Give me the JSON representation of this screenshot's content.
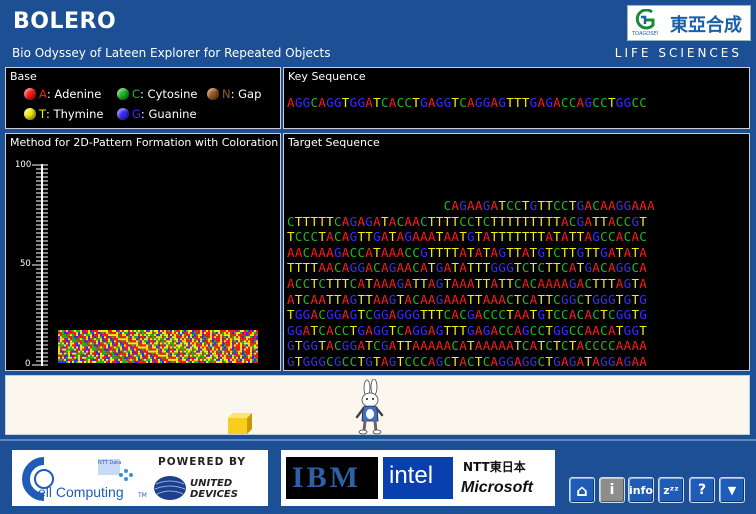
{
  "header": {
    "title": "BOLERO",
    "subtitle": "Bio Odyssey of Lateen Explorer for Repeated Objects",
    "division": "LIFE SCIENCES",
    "logo_text": "東亞合成",
    "logo_sub": "TOAGOSEI"
  },
  "colors": {
    "A": "#ff1a1a",
    "C": "#1fb824",
    "N": "#9a5a1e",
    "T": "#f3ee10",
    "G": "#3a2cff",
    "brand_blue": "#1c4f94"
  },
  "base_panel": {
    "title": "Base",
    "items": [
      {
        "letter": "A",
        "name": ": Adenine",
        "icon": "red-ball-icon"
      },
      {
        "letter": "C",
        "name": ": Cytosine",
        "icon": "green-ball-icon"
      },
      {
        "letter": "N",
        "name": ": Gap",
        "icon": "brown-ball-icon"
      },
      {
        "letter": "T",
        "name": ": Thymine",
        "icon": "yellow-ball-icon"
      },
      {
        "letter": "G",
        "name": ": Guanine",
        "icon": "blue-ball-icon"
      }
    ]
  },
  "key_panel": {
    "title": "Key Sequence",
    "sequence": "AGGCAGGTGGATCACCTGAGGTCAGGAGTTTGAGACCAGCCTGGCC"
  },
  "method_panel": {
    "title": "Method for 2D-Pattern Formation with Coloration",
    "ruler_labels": [
      "100",
      "50",
      "0"
    ],
    "pattern_fill_percent": 16
  },
  "target_panel": {
    "title": "Target Sequence",
    "lines": [
      "                    CAGAAGATCCTGTTCCTGACAAGGAAA",
      "CTTTTTCAGAGATACAACTTTTCCTCTTTTTTTTTACGATTACCGT",
      "TCCCTACAGTTGATAGAAATAATGTATTTTTTTATATTAGCCACAC",
      "AACAAAGACCATAAACCGTTTTATATAGTTATGTCTTGTTGATATA",
      "TTTTAACAGGACAGAACATGATATTTGGGTCTCTTCATGACAGGCA",
      "ACCTCTTTCATAAAGATTAGTAAATTATTCACAAAAGACTTTAGTA",
      "ATCAATTAGTTAAGTACAAGAAATTAAACTCATTCGGCTGGGTGTG",
      "TGGACGGAGTCGGAGGGTTTCACGACCCTAATGTCCACACTCGGTG",
      "GGATCACCTGAGGTCAGGAGTTTGAGACCAGCCTGGCCAACATGGT",
      "GTGGTACGGATCGATTAAAAACATAAAAATCATCTCTACCCCAAAA",
      "GTGGGCGCCTGTAGTCCCAGCTACTCAGGAGGCTGAGATAGGAGAA"
    ]
  },
  "stage": {
    "rabbit_icon": "rabbit-mascot-icon",
    "block_icon": "yellow-cube-icon"
  },
  "footer": {
    "cell_logo_text": "ell Computing",
    "cell_logo_tm": "TM",
    "ntt_beta": "NTT Data",
    "powered_by": "POWERED BY",
    "united_devices": "UNITED DEVICES",
    "ibm": "IBM",
    "intel": "intel",
    "ntt": "NTT東日本",
    "microsoft": "Microsoft",
    "nav_buttons": [
      {
        "name": "home-button",
        "label": "⌂",
        "icon": "home-icon"
      },
      {
        "name": "about-button",
        "label": "i",
        "icon": "info-circle-icon"
      },
      {
        "name": "info-button",
        "label": "info",
        "icon": "info-text-icon"
      },
      {
        "name": "sleep-button",
        "label": "zᶻᶻ",
        "icon": "sleep-icon"
      },
      {
        "name": "help-button",
        "label": "?",
        "icon": "help-icon"
      },
      {
        "name": "menu-button",
        "label": "▼",
        "icon": "chevron-down-icon"
      }
    ]
  }
}
